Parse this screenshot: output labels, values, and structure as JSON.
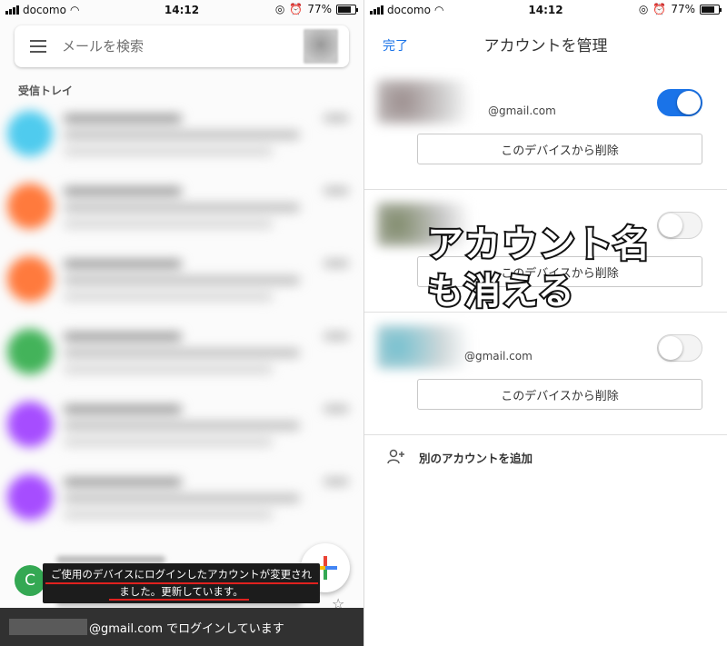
{
  "left": {
    "status": {
      "carrier": "docomo",
      "time": "14:12",
      "battery": "77%"
    },
    "search": {
      "placeholder": "メールを検索"
    },
    "inbox_label": "受信トレイ",
    "avatar_letter": "C",
    "tooltip": {
      "line1": "ご使用のデバイスにログインしたアカウントが変更され",
      "line2": "ました。更新しています。"
    },
    "snackbar": {
      "text": "@gmail.com でログインしています"
    },
    "colors": {
      "row_dots": [
        "#4fcbee",
        "#ff7a3d",
        "#ff7a3d",
        "#43b35a",
        "#a64dff",
        "#a64dff"
      ]
    }
  },
  "right": {
    "status": {
      "carrier": "docomo",
      "time": "14:12",
      "battery": "77%"
    },
    "nav": {
      "done": "完了",
      "title": "アカウントを管理"
    },
    "accounts": [
      {
        "email": "@gmail.com",
        "toggle_on": true,
        "remove_label": "このデバイスから削除"
      },
      {
        "email": "",
        "toggle_on": false,
        "remove_label": "このデバイスから削除"
      },
      {
        "email": "@gmail.com",
        "toggle_on": false,
        "remove_label": "このデバイスから削除"
      }
    ],
    "add_account": "別のアカウントを追加",
    "colors": {
      "accent": "#1a73e8"
    }
  },
  "caption": {
    "line1": "アカウント名",
    "line2": "も消える"
  }
}
